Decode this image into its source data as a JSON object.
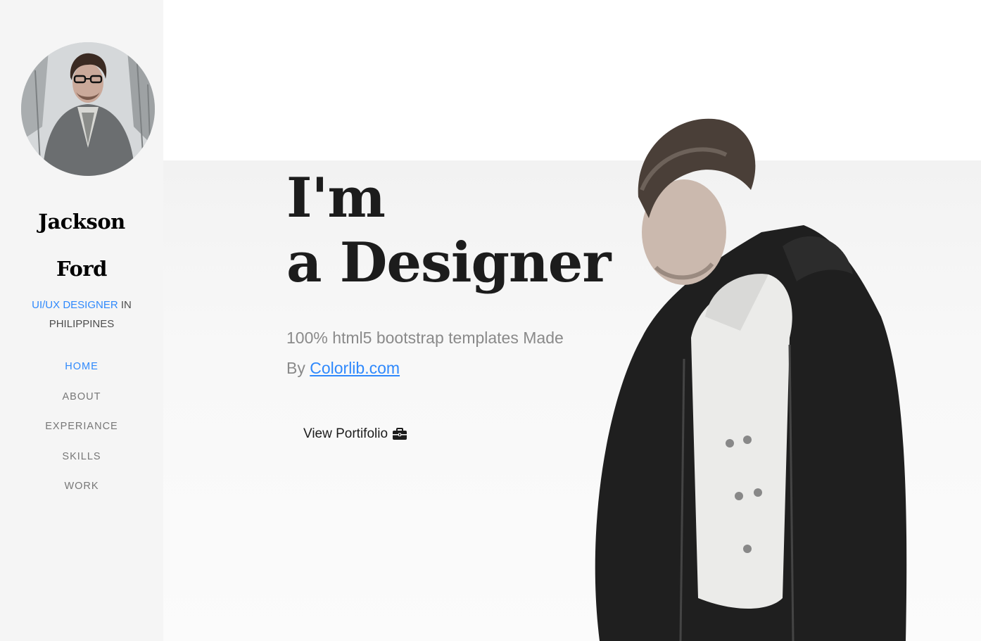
{
  "profile": {
    "first_name": "Jackson",
    "last_name": "Ford",
    "role_highlight": "UI/UX DESIGNER",
    "role_in": "IN",
    "location": "PHILIPPINES"
  },
  "nav": {
    "items": [
      {
        "label": "HOME",
        "active": true
      },
      {
        "label": "ABOUT",
        "active": false
      },
      {
        "label": "EXPERIANCE",
        "active": false
      },
      {
        "label": "SKILLS",
        "active": false
      },
      {
        "label": "WORK",
        "active": false
      }
    ]
  },
  "hero": {
    "line1": "I'm",
    "line2": "a Designer",
    "subtitle_line1": "100% html5 bootstrap templates Made",
    "subtitle_by": "By",
    "subtitle_link": "Colorlib.com",
    "cta_label": "View Portifolio",
    "cta_icon": "briefcase-icon"
  },
  "colors": {
    "accent": "#2f89fc",
    "sidebar_bg": "#f5f5f5",
    "heading": "#1c1c1c",
    "muted": "#8a8a8a"
  }
}
